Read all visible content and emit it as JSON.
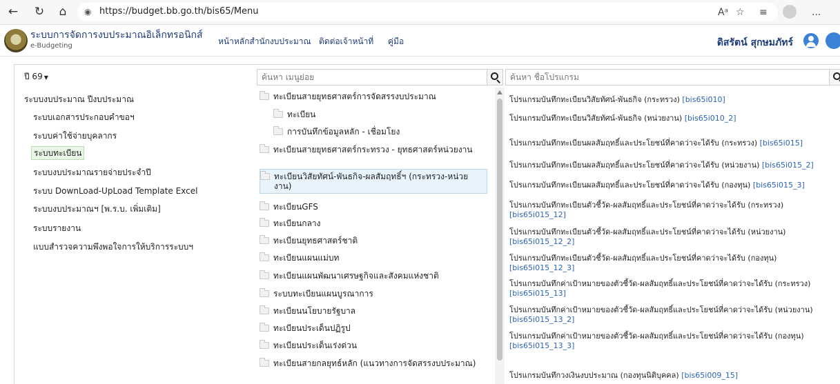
{
  "browser": {
    "url": "https://budget.bb.go.th/bis65/Menu",
    "back_icon": "back-arrow",
    "refresh_icon": "refresh",
    "home_icon": "home",
    "read_aloud_label": "Aᵃ",
    "favorite_icon": "star",
    "more_label": "..."
  },
  "header": {
    "app_title": "ระบบการจัดการงบประมาณอิเล็กทรอนิกส์",
    "app_subtitle": "e-Budgeting",
    "nav_links": [
      "หน้าหลักสำนักงบประมาณ",
      "ติดต่อเจ้าหน้าที่",
      "คู่มือ"
    ],
    "user_name": "ดิสรัตน์ สุกษมภัทร์"
  },
  "sidebar": {
    "year": "ปี 69",
    "menu_title": "ระบบงบประมาณ ปีงบประมาณ",
    "items": [
      {
        "label": "ระบบเอกสารประกอบคำขอฯ",
        "active": false
      },
      {
        "label": "ระบบค่าใช้จ่ายบุคลากร",
        "active": false
      },
      {
        "label": "ระบบทะเบียน",
        "active": true
      },
      {
        "label": "ระบบงบประมาณรายจ่ายประจำปี",
        "active": false
      },
      {
        "label": "ระบบ DownLoad-UpLoad Template Excel",
        "active": false
      },
      {
        "label": "ระบบงบประมาณฯ [พ.ร.บ. เพิ่มเติม]",
        "active": false
      },
      {
        "label": "ระบบรายงาน",
        "active": false
      },
      {
        "label": "แบบสำรวจความพึงพอใจการให้บริการระบบฯ",
        "active": false
      }
    ]
  },
  "submenu": {
    "search_placeholder": "ค้นหา เมนูย่อย",
    "folders": [
      {
        "label": "ทะเบียนสายยุทธศาสตร์การจัดสรรงบประมาณ",
        "indent": false
      },
      {
        "label": "ทะเบียน",
        "indent": true
      },
      {
        "label": "การบันทึกข้อมูลหลัก - เชื่อมโยง",
        "indent": true
      },
      {
        "label": "ทะเบียนสายยุทธศาสตร์กระทรวง - ยุทธศาสตร์หน่วยงาน",
        "indent": false
      },
      {
        "label": "ทะเบียนวิสัยทัศน์-พันธกิจ-ผลสัมฤทธิ์ฯ (กระทรวง-หน่วยงาน)",
        "indent": false,
        "selected": true
      },
      {
        "label": "ทะเบียนGFS",
        "indent": false
      },
      {
        "label": "ทะเบียนกลาง",
        "indent": false
      },
      {
        "label": "ทะเบียนยุทธศาสตร์ชาติ",
        "indent": false
      },
      {
        "label": "ทะเบียนแผนแม่บท",
        "indent": false
      },
      {
        "label": "ทะเบียนแผนพัฒนาเศรษฐกิจและสังคมแห่งชาติ",
        "indent": false
      },
      {
        "label": "ระบบทะเบียนแผนบูรณาการ",
        "indent": false
      },
      {
        "label": "ทะเบียนนโยบายรัฐบาล",
        "indent": false
      },
      {
        "label": "ทะเบียนประเด็นปฏิรูป",
        "indent": false
      },
      {
        "label": "ทะเบียนประเด็นเร่งด่วน",
        "indent": false
      },
      {
        "label": "ทะเบียนสายกลยุทธ์หลัก (แนวทางการจัดสรรงบประมาณ)",
        "indent": false
      }
    ]
  },
  "programs": {
    "search_placeholder": "ค้นหา ชื่อโปรแกรม",
    "items": [
      {
        "text": "โปรแกรมบันทึกทะเบียนวิสัยทัศน์-พันธกิจ (กระทรวง)",
        "code": "[bis65i010]"
      },
      {
        "text": "โปรแกรมบันทึกทะเบียนวิสัยทัศน์-พันธกิจ (หน่วยงาน)",
        "code": "[bis65i010_2]"
      },
      {
        "text": "โปรแกรมบันทึกทะเบียนผลสัมฤทธิ์และประโยชน์ที่คาดว่าจะได้รับ (กระทรวง)",
        "code": "[bis65i015]"
      },
      {
        "text": "โปรแกรมบันทึกทะเบียนผลสัมฤทธิ์และประโยชน์ที่คาดว่าจะได้รับ (หน่วยงาน)",
        "code": "[bis65i015_2]"
      },
      {
        "text": "โปรแกรมบันทึกทะเบียนผลสัมฤทธิ์และประโยชน์ที่คาดว่าจะได้รับ (กองทุน)",
        "code": "[bis65i015_3]"
      },
      {
        "text": "โปรแกรมบันทึกทะเบียนตัวชี้วัด-ผลสัมฤทธิ์และประโยชน์ที่คาดว่าจะได้รับ (กระทรวง)",
        "code": "[bis65i015_12]"
      },
      {
        "text": "โปรแกรมบันทึกทะเบียนตัวชี้วัด-ผลสัมฤทธิ์และประโยชน์ที่คาดว่าจะได้รับ (หน่วยงาน)",
        "code": "[bis65i015_12_2]"
      },
      {
        "text": "โปรแกรมบันทึกทะเบียนตัวชี้วัด-ผลสัมฤทธิ์และประโยชน์ที่คาดว่าจะได้รับ (กองทุน)",
        "code": "[bis65i015_12_3]"
      },
      {
        "text": "โปรแกรมบันทึกค่าเป้าหมายของตัวชี้วัด-ผลสัมฤทธิ์และประโยชน์ที่คาดว่าจะได้รับ (กระทรวง)",
        "code": "[bis65i015_13]"
      },
      {
        "text": "โปรแกรมบันทึกค่าเป้าหมายของตัวชี้วัด-ผลสัมฤทธิ์และประโยชน์ที่คาดว่าจะได้รับ (หน่วยงาน)",
        "code": "[bis65i015_13_2]"
      },
      {
        "text": "โปรแกรมบันทึกค่าเป้าหมายของตัวชี้วัด-ผลสัมฤทธิ์และประโยชน์ที่คาดว่าจะได้รับ (กองทุน)",
        "code": "[bis65i015_13_3]"
      },
      {
        "text": "โปรแกรมบันทึกวงเงินงบประมาณ (กองทุนนิติบุคคล)",
        "code": "[bis65i009_15]"
      }
    ]
  },
  "colors": {
    "link": "#2a63b8",
    "brand": "#1f3d7a",
    "active_menu_bg": "#eaf7e6",
    "selected_folder_bg": "#e8f3fb"
  }
}
